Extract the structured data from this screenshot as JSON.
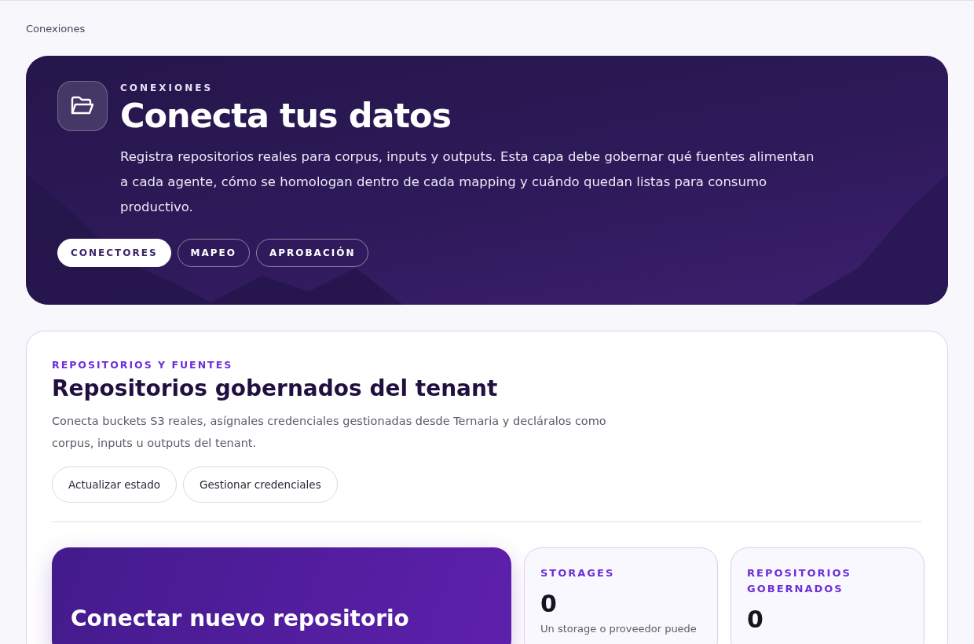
{
  "breadcrumb": "Conexiones",
  "hero": {
    "eyebrow": "CONEXIONES",
    "title": "Conecta tus datos",
    "description": "Registra repositorios reales para corpus, inputs y outputs. Esta capa debe gobernar qué fuentes alimentan a cada agente, cómo se homologan dentro de cada mapping y cuándo quedan listas para consumo productivo.",
    "tabs": [
      {
        "label": "CONECTORES",
        "selected": true
      },
      {
        "label": "MAPEO",
        "selected": false
      },
      {
        "label": "APROBACIÓN",
        "selected": false
      }
    ]
  },
  "section": {
    "eyebrow": "REPOSITORIOS Y FUENTES",
    "title": "Repositorios gobernados del tenant",
    "description": "Conecta buckets S3 reales, asígnales credenciales gestionadas desde Ternaria y decláralos como corpus, inputs u outputs del tenant.",
    "buttons": [
      "Actualizar estado",
      "Gestionar credenciales"
    ],
    "connect_card": {
      "title": "Conectar nuevo repositorio"
    },
    "stats": [
      {
        "label": "STORAGES",
        "value": "0",
        "note": "Un storage o proveedor puede"
      },
      {
        "label": "REPOSITORIOS GOBERNADOS",
        "value": "0"
      }
    ]
  }
}
